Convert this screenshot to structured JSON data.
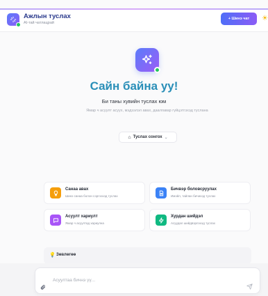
{
  "header": {
    "title": "Ажлын туслах",
    "subtitle": "AI-тай чатлацрай",
    "new_chat_label": "+ Шинэ чат",
    "accent": "#4f6ef7"
  },
  "hero": {
    "greeting": "Сайн байна уу!",
    "tagline": "Би таны хувийн туслах юм",
    "description": "Ямар ч асуулт асуух, мэдээлэл авах, даалгавар гүйцэтгэхэд туслана"
  },
  "assistant_select": {
    "label": "Туслах сонгох"
  },
  "cards": [
    {
      "title": "Санаа авах",
      "desc": "Шинэ санаа болон сэргээхэд туслах",
      "icon": "lightbulb-icon",
      "color": "#f59e0b"
    },
    {
      "title": "Бичвэр боловсруулах",
      "desc": "Имэйл, тайлан бичихэд туслах",
      "icon": "document-icon",
      "color": "#3b82f6"
    },
    {
      "title": "Асуулт хариулт",
      "desc": "Ямар ч асуултад хариулна",
      "icon": "chat-icon",
      "color": "#a855f7"
    },
    {
      "title": "Хурдан шийдэл",
      "desc": "Асуудал шийдвэрлэхэд туслах",
      "icon": "bolt-icon",
      "color": "#10b981"
    }
  ],
  "suggestions": {
    "label": "Зөвлөгөө"
  },
  "composer": {
    "placeholder": "Асуултаа бичнэ үү..."
  }
}
